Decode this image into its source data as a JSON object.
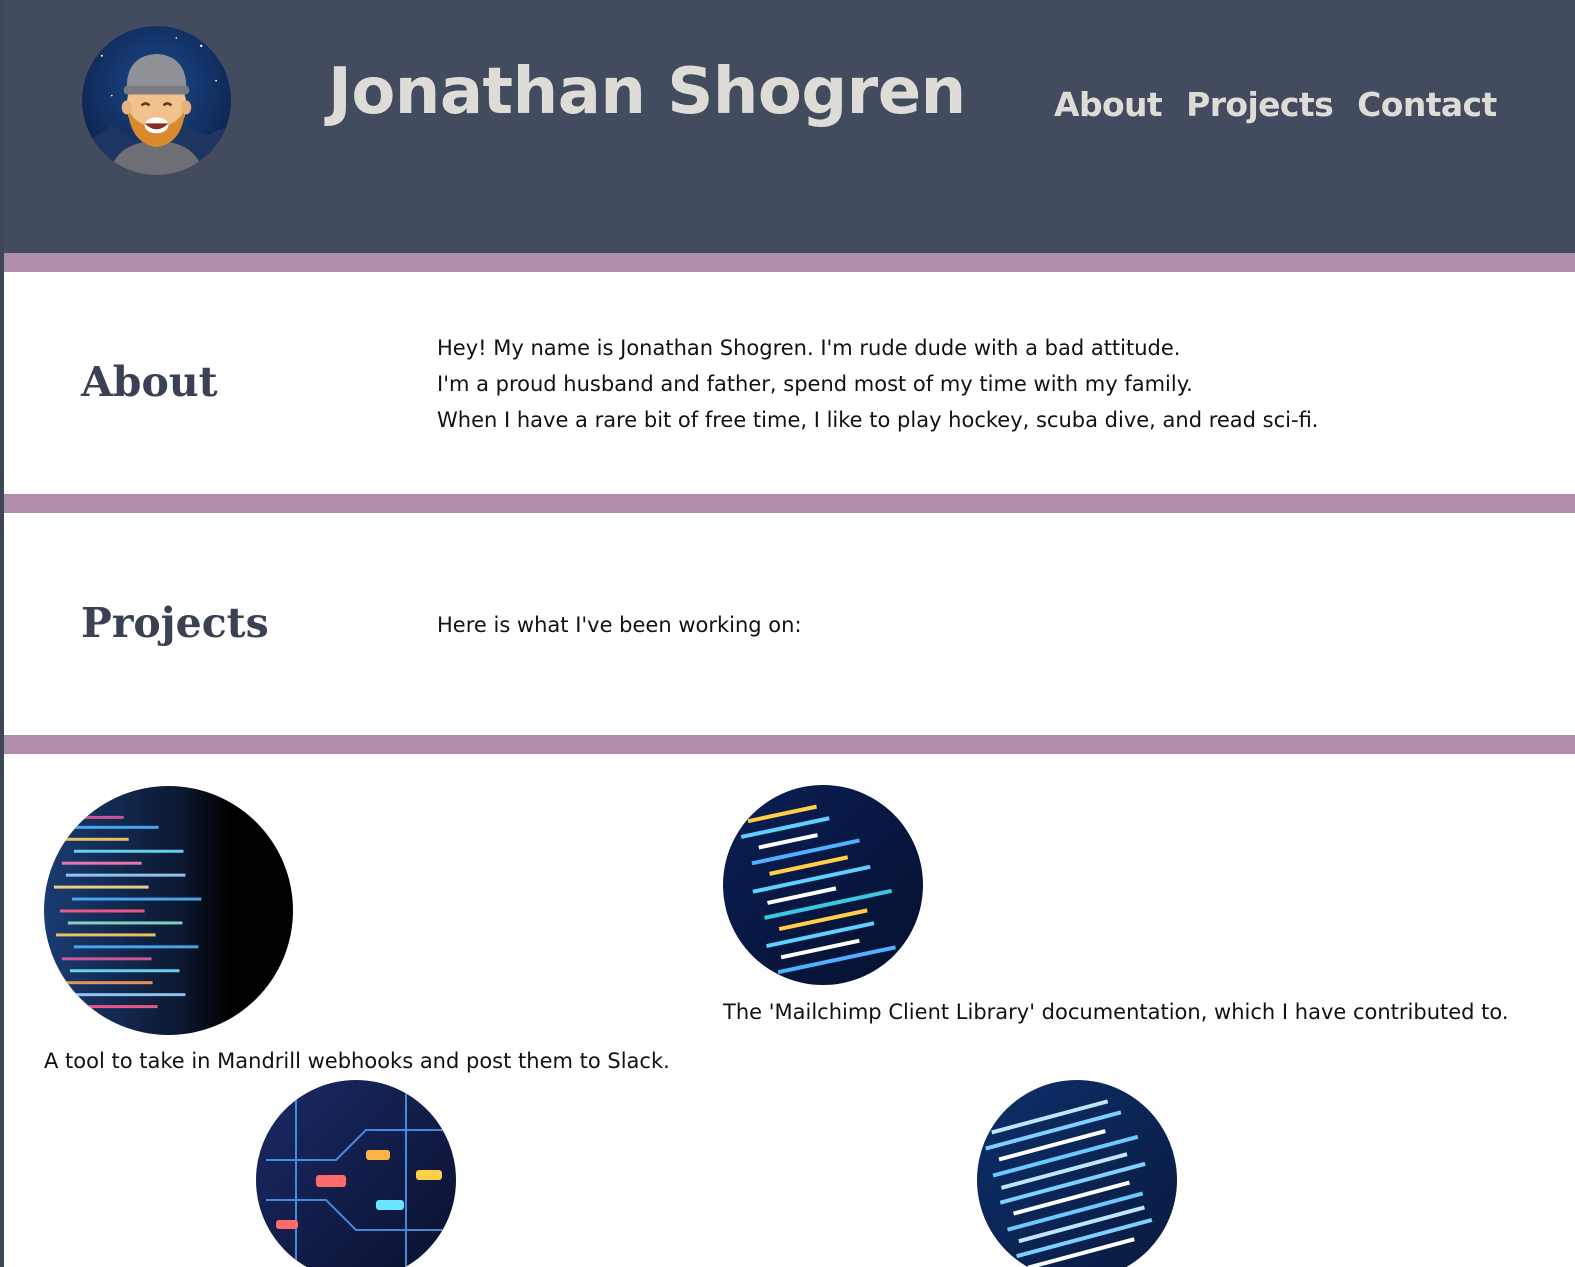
{
  "header": {
    "title": "Jonathan Shogren",
    "avatar_icon": "avatar-illustration-icon",
    "nav": [
      {
        "label": "About"
      },
      {
        "label": "Projects"
      },
      {
        "label": "Contact"
      }
    ]
  },
  "about": {
    "heading": "About",
    "lines": [
      "Hey! My name is Jonathan Shogren. I'm rude dude with a bad attitude.",
      "I'm a proud husband and father, spend most of my time with my family.",
      "When I have a rare bit of free time, I like to play hockey, scuba dive, and read sci-fi."
    ]
  },
  "projects": {
    "heading": "Projects",
    "intro": "Here is what I've been working on:",
    "items": [
      {
        "caption": "A tool to take in Mandrill webhooks and post them to Slack.",
        "image_icon": "code-screen-image"
      },
      {
        "caption": "The 'Mailchimp Client Library' documentation, which I have contributed to.",
        "image_icon": "code-screen-image"
      },
      {
        "caption": "",
        "image_icon": "circuit-diagram-image"
      },
      {
        "caption": "",
        "image_icon": "code-screen-image"
      }
    ]
  },
  "colors": {
    "header_bg": "#434b5e",
    "divider": "#b18dad",
    "header_text": "#dedcd6",
    "heading_text": "#3a4153"
  }
}
